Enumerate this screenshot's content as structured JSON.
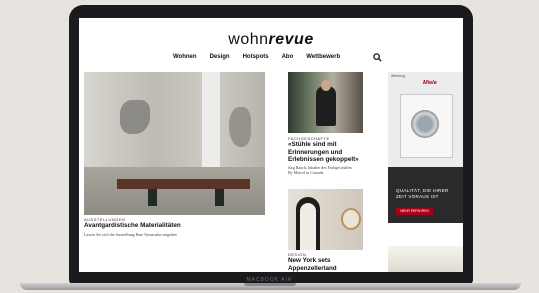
{
  "site": {
    "logo_plain": "wohn",
    "logo_italic": "revue"
  },
  "nav": {
    "items": [
      "Wohnen",
      "Design",
      "Hotspots",
      "Abo",
      "Wettbewerb"
    ],
    "search_icon": "search-icon"
  },
  "hero_article": {
    "kicker": "AUSSTELLUNGEN",
    "headline": "Avantgardistische Materialitäten",
    "teaser": "Lassen Sie sich die Ausstellung Rare Vernacular entgehen"
  },
  "side_article_1": {
    "kicker": "FACHGESCHÄFTE",
    "headline_line1": "«Stühle sind mit",
    "headline_line2": "Erinnerungen und",
    "headline_line3": "Erlebnissen gekoppelt»",
    "teaser_line1": "Jürg Rauch, Inhaber des Fachgeschäftes",
    "teaser_line2": "By Marcel in Conrads"
  },
  "side_article_2": {
    "kicker": "DESIGN",
    "headline_line1": "New York sets",
    "headline_line2": "Appenzellerland"
  },
  "ad": {
    "tag": "Werbung",
    "logo": "Miele",
    "claim_line1": "QUALITÄT, DIE IHRER",
    "claim_line2": "ZEIT VORAUS IST",
    "button": "MEHR ERFAHREN"
  },
  "device": {
    "brand_label": "MACBOOK AIR"
  },
  "colors": {
    "brand_red": "#a6001a",
    "bezel": "#1b1b1d",
    "background": "#e7e4df"
  }
}
